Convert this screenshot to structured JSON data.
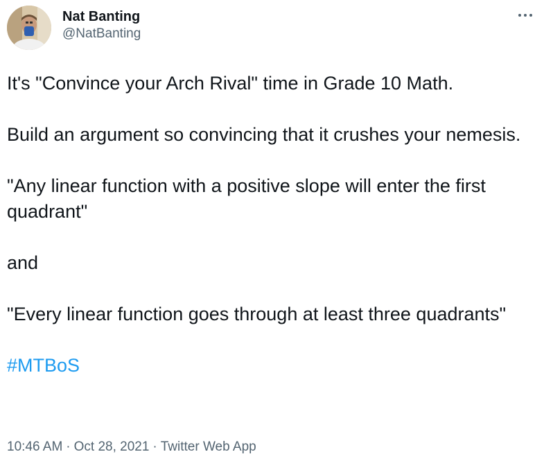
{
  "author": {
    "display_name": "Nat Banting",
    "handle": "@NatBanting"
  },
  "menu_icon": "more-horizontal-icon",
  "tweet": {
    "lines": {
      "l1": "It's \"Convince your Arch Rival\" time in Grade 10 Math.",
      "l2": "Build an argument so convincing that it crushes your nemesis.",
      "l3": "\"Any linear function with a positive slope will enter the first quadrant\"",
      "l4": "and",
      "l5": "\"Every linear function goes through at least three quadrants\""
    },
    "hashtag": "#MTBoS"
  },
  "meta": {
    "time": "10:46 AM",
    "separator": "·",
    "date": "Oct 28, 2021",
    "source": "Twitter Web App"
  },
  "colors": {
    "text": "#0f1419",
    "secondary": "#536471",
    "link": "#1d9bf0"
  }
}
